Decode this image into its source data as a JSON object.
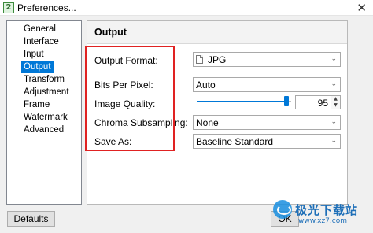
{
  "window": {
    "app_icon_glyph": "2",
    "title": "Preferences...",
    "close_glyph": "✕"
  },
  "nav": {
    "items": [
      {
        "label": "General"
      },
      {
        "label": "Interface"
      },
      {
        "label": "Input"
      },
      {
        "label": "Output",
        "selected": true
      },
      {
        "label": "Transform"
      },
      {
        "label": "Adjustment"
      },
      {
        "label": "Frame"
      },
      {
        "label": "Watermark"
      },
      {
        "label": "Advanced"
      }
    ]
  },
  "section": {
    "title": "Output"
  },
  "fields": {
    "output_format": {
      "label": "Output Format:",
      "value": "JPG",
      "icon": "file-icon"
    },
    "bits_per_pixel": {
      "label": "Bits Per Pixel:",
      "value": "Auto"
    },
    "image_quality": {
      "label": "Image Quality:",
      "value": "95",
      "slider_level": 0.95
    },
    "chroma_subsampling": {
      "label": "Chroma Subsampling:",
      "value": "None"
    },
    "save_as": {
      "label": "Save As:",
      "value": "Baseline Standard"
    }
  },
  "combo_arrow_glyph": "⌄",
  "spin": {
    "up_glyph": "▲",
    "down_glyph": "▼"
  },
  "buttons": {
    "defaults": "Defaults",
    "ok": "OK"
  },
  "watermark": {
    "text": "极光下载站",
    "url": "www.xz7.com"
  },
  "colors": {
    "accent": "#0078d7",
    "highlight_border": "#e02222",
    "watermark": "#1e6fb8"
  }
}
